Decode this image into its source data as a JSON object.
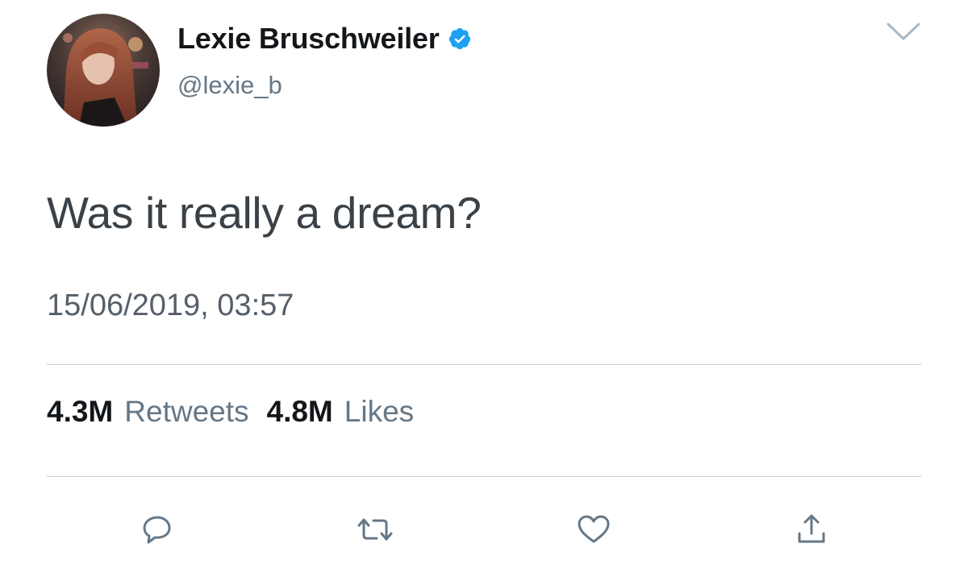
{
  "tweet": {
    "author": {
      "display_name": "Lexie Bruschweiler",
      "handle": "@lexie_b",
      "verified": true
    },
    "text": "Was it really a dream?",
    "timestamp": "15/06/2019, 03:57",
    "stats": {
      "retweets_count": "4.3M",
      "retweets_label": "Retweets",
      "likes_count": "4.8M",
      "likes_label": "Likes"
    },
    "actions": [
      "reply-icon",
      "retweet-icon",
      "like-icon",
      "share-icon"
    ]
  },
  "colors": {
    "verified_blue": "#1da1f2",
    "secondary_text": "#657786",
    "primary_text": "#14171a",
    "divider": "#c8cfd6"
  }
}
